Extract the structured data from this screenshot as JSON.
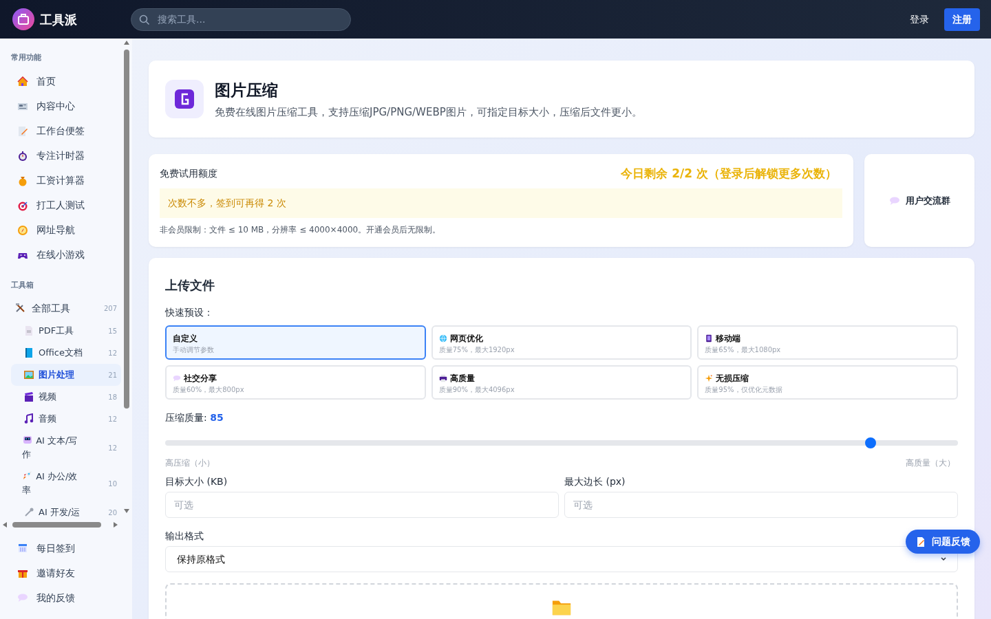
{
  "app": {
    "name": "工具派"
  },
  "search": {
    "placeholder": "搜索工具..."
  },
  "auth": {
    "login": "登录",
    "register": "注册"
  },
  "sidebar": {
    "common": {
      "title": "常用功能",
      "items": [
        {
          "label": "首页"
        },
        {
          "label": "内容中心"
        },
        {
          "label": "工作台便签"
        },
        {
          "label": "专注计时器"
        },
        {
          "label": "工资计算器"
        },
        {
          "label": "打工人测试"
        },
        {
          "label": "网址导航"
        },
        {
          "label": "在线小游戏"
        }
      ]
    },
    "toolbox": {
      "title": "工具箱",
      "items": [
        {
          "label": "全部工具",
          "count": "207",
          "selected": false,
          "children": [
            {
              "label": "PDF工具",
              "count": "15",
              "selected": false
            },
            {
              "label": "Office文档",
              "count": "12",
              "selected": false
            },
            {
              "label": "图片处理",
              "count": "21",
              "selected": true
            },
            {
              "label": "视频",
              "count": "18",
              "selected": false
            },
            {
              "label": "音频",
              "count": "12",
              "selected": false
            },
            {
              "label": "AI 文本/写作",
              "count": "12",
              "selected": false
            },
            {
              "label": "AI 办公/效率",
              "count": "10",
              "selected": false
            },
            {
              "label": "AI 开发/运",
              "count": "20",
              "selected": false
            }
          ]
        }
      ]
    },
    "bottom_items": [
      {
        "label": "每日签到"
      },
      {
        "label": "邀请好友"
      },
      {
        "label": "我的反馈"
      }
    ]
  },
  "tool": {
    "title": "图片压缩",
    "description": "免费在线图片压缩工具，支持压缩JPG/PNG/WEBP图片，可指定目标大小，压缩后文件更小。"
  },
  "quota": {
    "title": "免费试用额度",
    "remaining": "今日剩余 2/2 次（登录后解锁更多次数）",
    "notice": "次数不多，签到可再得 2 次",
    "limits": "非会员限制：文件 ≤ 10 MB，分辨率 ≤ 4000×4000。开通会员后无限制。"
  },
  "community": {
    "label": "用户交流群"
  },
  "upload": {
    "title": "上传文件",
    "presets_label": "快速预设：",
    "presets": [
      {
        "name": "自定义",
        "detail": "手动调节参数",
        "selected": true
      },
      {
        "name": "网页优化",
        "detail": "质量75%，最大1920px",
        "selected": false
      },
      {
        "name": "移动端",
        "detail": "质量65%，最大1080px",
        "selected": false
      },
      {
        "name": "社交分享",
        "detail": "质量60%，最大800px",
        "selected": false
      },
      {
        "name": "高质量",
        "detail": "质量90%，最大4096px",
        "selected": false
      },
      {
        "name": "无损压缩",
        "detail": "质量95%，仅优化元数据",
        "selected": false
      }
    ],
    "quality": {
      "label": "压缩质量:",
      "value": "85",
      "level": 0.89,
      "min_label": "高压缩（小）",
      "max_label": "高质量（大）"
    },
    "target_size": {
      "label": "目标大小 (KB)",
      "placeholder": "可选"
    },
    "max_edge": {
      "label": "最大边长 (px)",
      "placeholder": "可选"
    },
    "format": {
      "label": "输出格式",
      "value": "保持原格式"
    }
  },
  "feedback_button": {
    "label": "问题反馈"
  }
}
